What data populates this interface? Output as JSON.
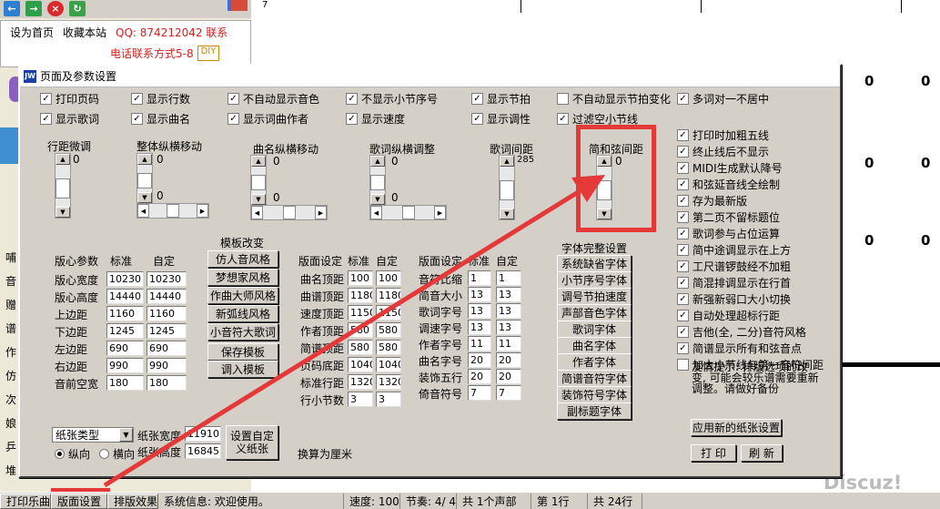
{
  "bg": {
    "links": [
      "设为首页",
      "收藏本站"
    ],
    "qq": "QQ: 874212042 联系",
    "sub": "电话联系方式5-8",
    "diy": "DIY",
    "page_number": "7",
    "zeros": [
      "0",
      "0",
      "0",
      "0",
      "0",
      "0"
    ],
    "side_chars": [
      "哺",
      "音",
      "赠",
      "谱",
      "作",
      "仿",
      "次",
      "娘",
      "乒",
      "堆"
    ]
  },
  "dialog": {
    "title": "页面及参数设置",
    "row1": [
      {
        "label": "打印页码",
        "checked": true
      },
      {
        "label": "显示行数",
        "checked": true
      },
      {
        "label": "不自动显示音色",
        "checked": true
      },
      {
        "label": "不显示小节序号",
        "checked": true
      },
      {
        "label": "显示节拍",
        "checked": true
      },
      {
        "label": "不自动显示节拍变化",
        "checked": false
      },
      {
        "label": "多词对一不居中",
        "checked": true
      }
    ],
    "row2": [
      {
        "label": "显示歌词",
        "checked": true
      },
      {
        "label": "显示曲名",
        "checked": true
      },
      {
        "label": "显示词曲作者",
        "checked": true
      },
      {
        "label": "显示速度",
        "checked": true
      },
      {
        "label": "显示调性",
        "checked": true
      },
      {
        "label": "过滤空小节线",
        "checked": true
      }
    ],
    "right_options": [
      {
        "label": "打印时加粗五线",
        "checked": true
      },
      {
        "label": "终止线后不显示",
        "checked": true
      },
      {
        "label": "MIDI生成默认降号",
        "checked": true
      },
      {
        "label": "和弦延音线全绘制",
        "checked": true
      },
      {
        "label": "存为最新版",
        "checked": true
      },
      {
        "label": "第二页不留标题位",
        "checked": true
      },
      {
        "label": "歌词参与占位运算",
        "checked": true
      },
      {
        "label": "简中途调显示在上方",
        "checked": true
      },
      {
        "label": "工尺谱锣鼓经不加粗",
        "checked": true
      },
      {
        "label": "简混排调显示在行首",
        "checked": true
      },
      {
        "label": "新强新弱口大小切换",
        "checked": true
      },
      {
        "label": "自动处理超标行距",
        "checked": true
      },
      {
        "label": "吉他(全, 二分)音符风格",
        "checked": true
      },
      {
        "label": "简谱显示所有和弦音点",
        "checked": true
      },
      {
        "label": "加大小节线与第一音符间距",
        "checked": false
      }
    ],
    "scroll_groups": [
      {
        "label": "行距微调",
        "value": "0"
      },
      {
        "label": "整体纵横移动",
        "value": "0",
        "value2": "0"
      },
      {
        "label": "曲名纵横移动",
        "value": "0",
        "value2": "0"
      },
      {
        "label": "歌词纵横调整",
        "value": "0",
        "value2": "0"
      },
      {
        "label": "歌词间距",
        "value": "285"
      },
      {
        "label": "简和弦间距",
        "value": "0"
      }
    ],
    "template": {
      "title": "模板改变",
      "buttons": [
        "仿人音风格",
        "梦想家风格",
        "作曲大师风格",
        "新弧线风格",
        "小音符大歌词",
        "保存模板",
        "调入模板"
      ]
    },
    "layout_params": {
      "headers": [
        "版心参数",
        "标准",
        "自定"
      ],
      "rows": [
        {
          "label": "版心宽度",
          "std": "10230",
          "custom": "10230"
        },
        {
          "label": "版心高度",
          "std": "14440",
          "custom": "14440"
        },
        {
          "label": "上边距",
          "std": "1160",
          "custom": "1160"
        },
        {
          "label": "下边距",
          "std": "1245",
          "custom": "1245"
        },
        {
          "label": "左边距",
          "std": "690",
          "custom": "690"
        },
        {
          "label": "右边距",
          "std": "990",
          "custom": "990"
        },
        {
          "label": "音前空宽",
          "std": "180",
          "custom": "180"
        }
      ]
    },
    "page_settings": {
      "headers": [
        "版面设定",
        "标准",
        "自定"
      ],
      "rows": [
        {
          "label": "曲名顶距",
          "std": "100",
          "custom": "100"
        },
        {
          "label": "曲谱顶距",
          "std": "1180",
          "custom": "1180"
        },
        {
          "label": "速度顶距",
          "std": "1150",
          "custom": "1150"
        },
        {
          "label": "作者顶距",
          "std": "580",
          "custom": "580"
        },
        {
          "label": "简谱顶距",
          "std": "580",
          "custom": "580"
        },
        {
          "label": "页码底距",
          "std": "1040",
          "custom": "1040"
        },
        {
          "label": "标准行距",
          "std": "1320",
          "custom": "1320"
        },
        {
          "label": "行小节数",
          "std": "3",
          "custom": "3"
        }
      ]
    },
    "page_settings2": {
      "headers": [
        "版面设定",
        "标准",
        "自定"
      ],
      "rows": [
        {
          "label": "音符比缩",
          "std": "1",
          "custom": "1"
        },
        {
          "label": "简音大小",
          "std": "13",
          "custom": "13"
        },
        {
          "label": "歌词字号",
          "std": "13",
          "custom": "13"
        },
        {
          "label": "调速字号",
          "std": "13",
          "custom": "13"
        },
        {
          "label": "作者字号",
          "std": "11",
          "custom": "11"
        },
        {
          "label": "曲名字号",
          "std": "20",
          "custom": "20"
        },
        {
          "label": "装饰五行",
          "std": "20",
          "custom": "20"
        },
        {
          "label": "倚音符号",
          "std": "7",
          "custom": "7"
        }
      ]
    },
    "fonts": {
      "title": "字体完整设置",
      "buttons": [
        "系统缺省字体",
        "小节序号字体",
        "调号节拍速度",
        "声部音色字体",
        "歌词字体",
        "曲名字体",
        "作者字体",
        "简谱音符字体",
        "装饰符号字体",
        "副标题字体"
      ]
    },
    "tip": "友情提示: 排版选项的改变, 可能会较乐谱需要重新调整。请做好备份",
    "apply_paper_button": "应用新的纸张设置",
    "print_button": "打 印",
    "refresh_button": "刷 新",
    "paper": {
      "type_label": "纸张类型",
      "width_label": "纸张宽度",
      "width_value": "11910",
      "height_label": "纸张高度",
      "height_value": "16845",
      "portrait": "纵向",
      "landscape": "横向",
      "custom_button_l1": "设置自定",
      "custom_button_l2": "义纸张",
      "unit_note": "换算为厘米"
    }
  },
  "statusbar": {
    "items": [
      "打印乐曲",
      "版面设置",
      "排版效果",
      "系统信息: 欢迎使用。",
      "速度: 100",
      "节奏: 4/ 4",
      "共 1个声部",
      "第 1行",
      "共 24行"
    ]
  },
  "watermark": "Discuz!",
  "colors": {
    "annotation_red": "#e53838",
    "dialog_bg": "#d4d0c8"
  }
}
